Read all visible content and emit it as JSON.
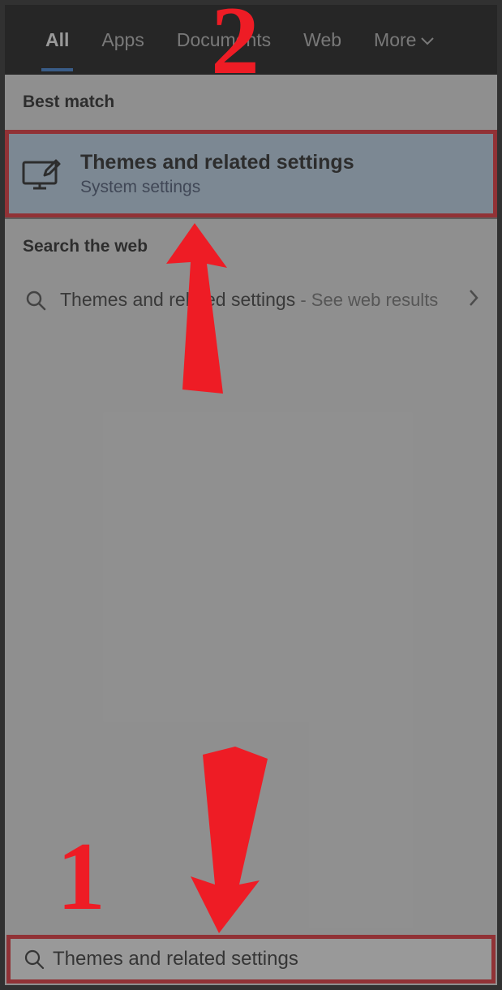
{
  "tabs": {
    "all": "All",
    "apps": "Apps",
    "documents": "Documents",
    "web": "Web",
    "more": "More"
  },
  "sections": {
    "best_match": "Best match",
    "search_web": "Search the web"
  },
  "best_match": {
    "title": "Themes and related settings",
    "subtitle": "System settings"
  },
  "web_result": {
    "query": "Themes and related settings",
    "suffix_sep": " - ",
    "suffix": "See web results"
  },
  "search": {
    "value": "Themes and related settings"
  },
  "annotations": {
    "step1": "1",
    "step2": "2"
  }
}
